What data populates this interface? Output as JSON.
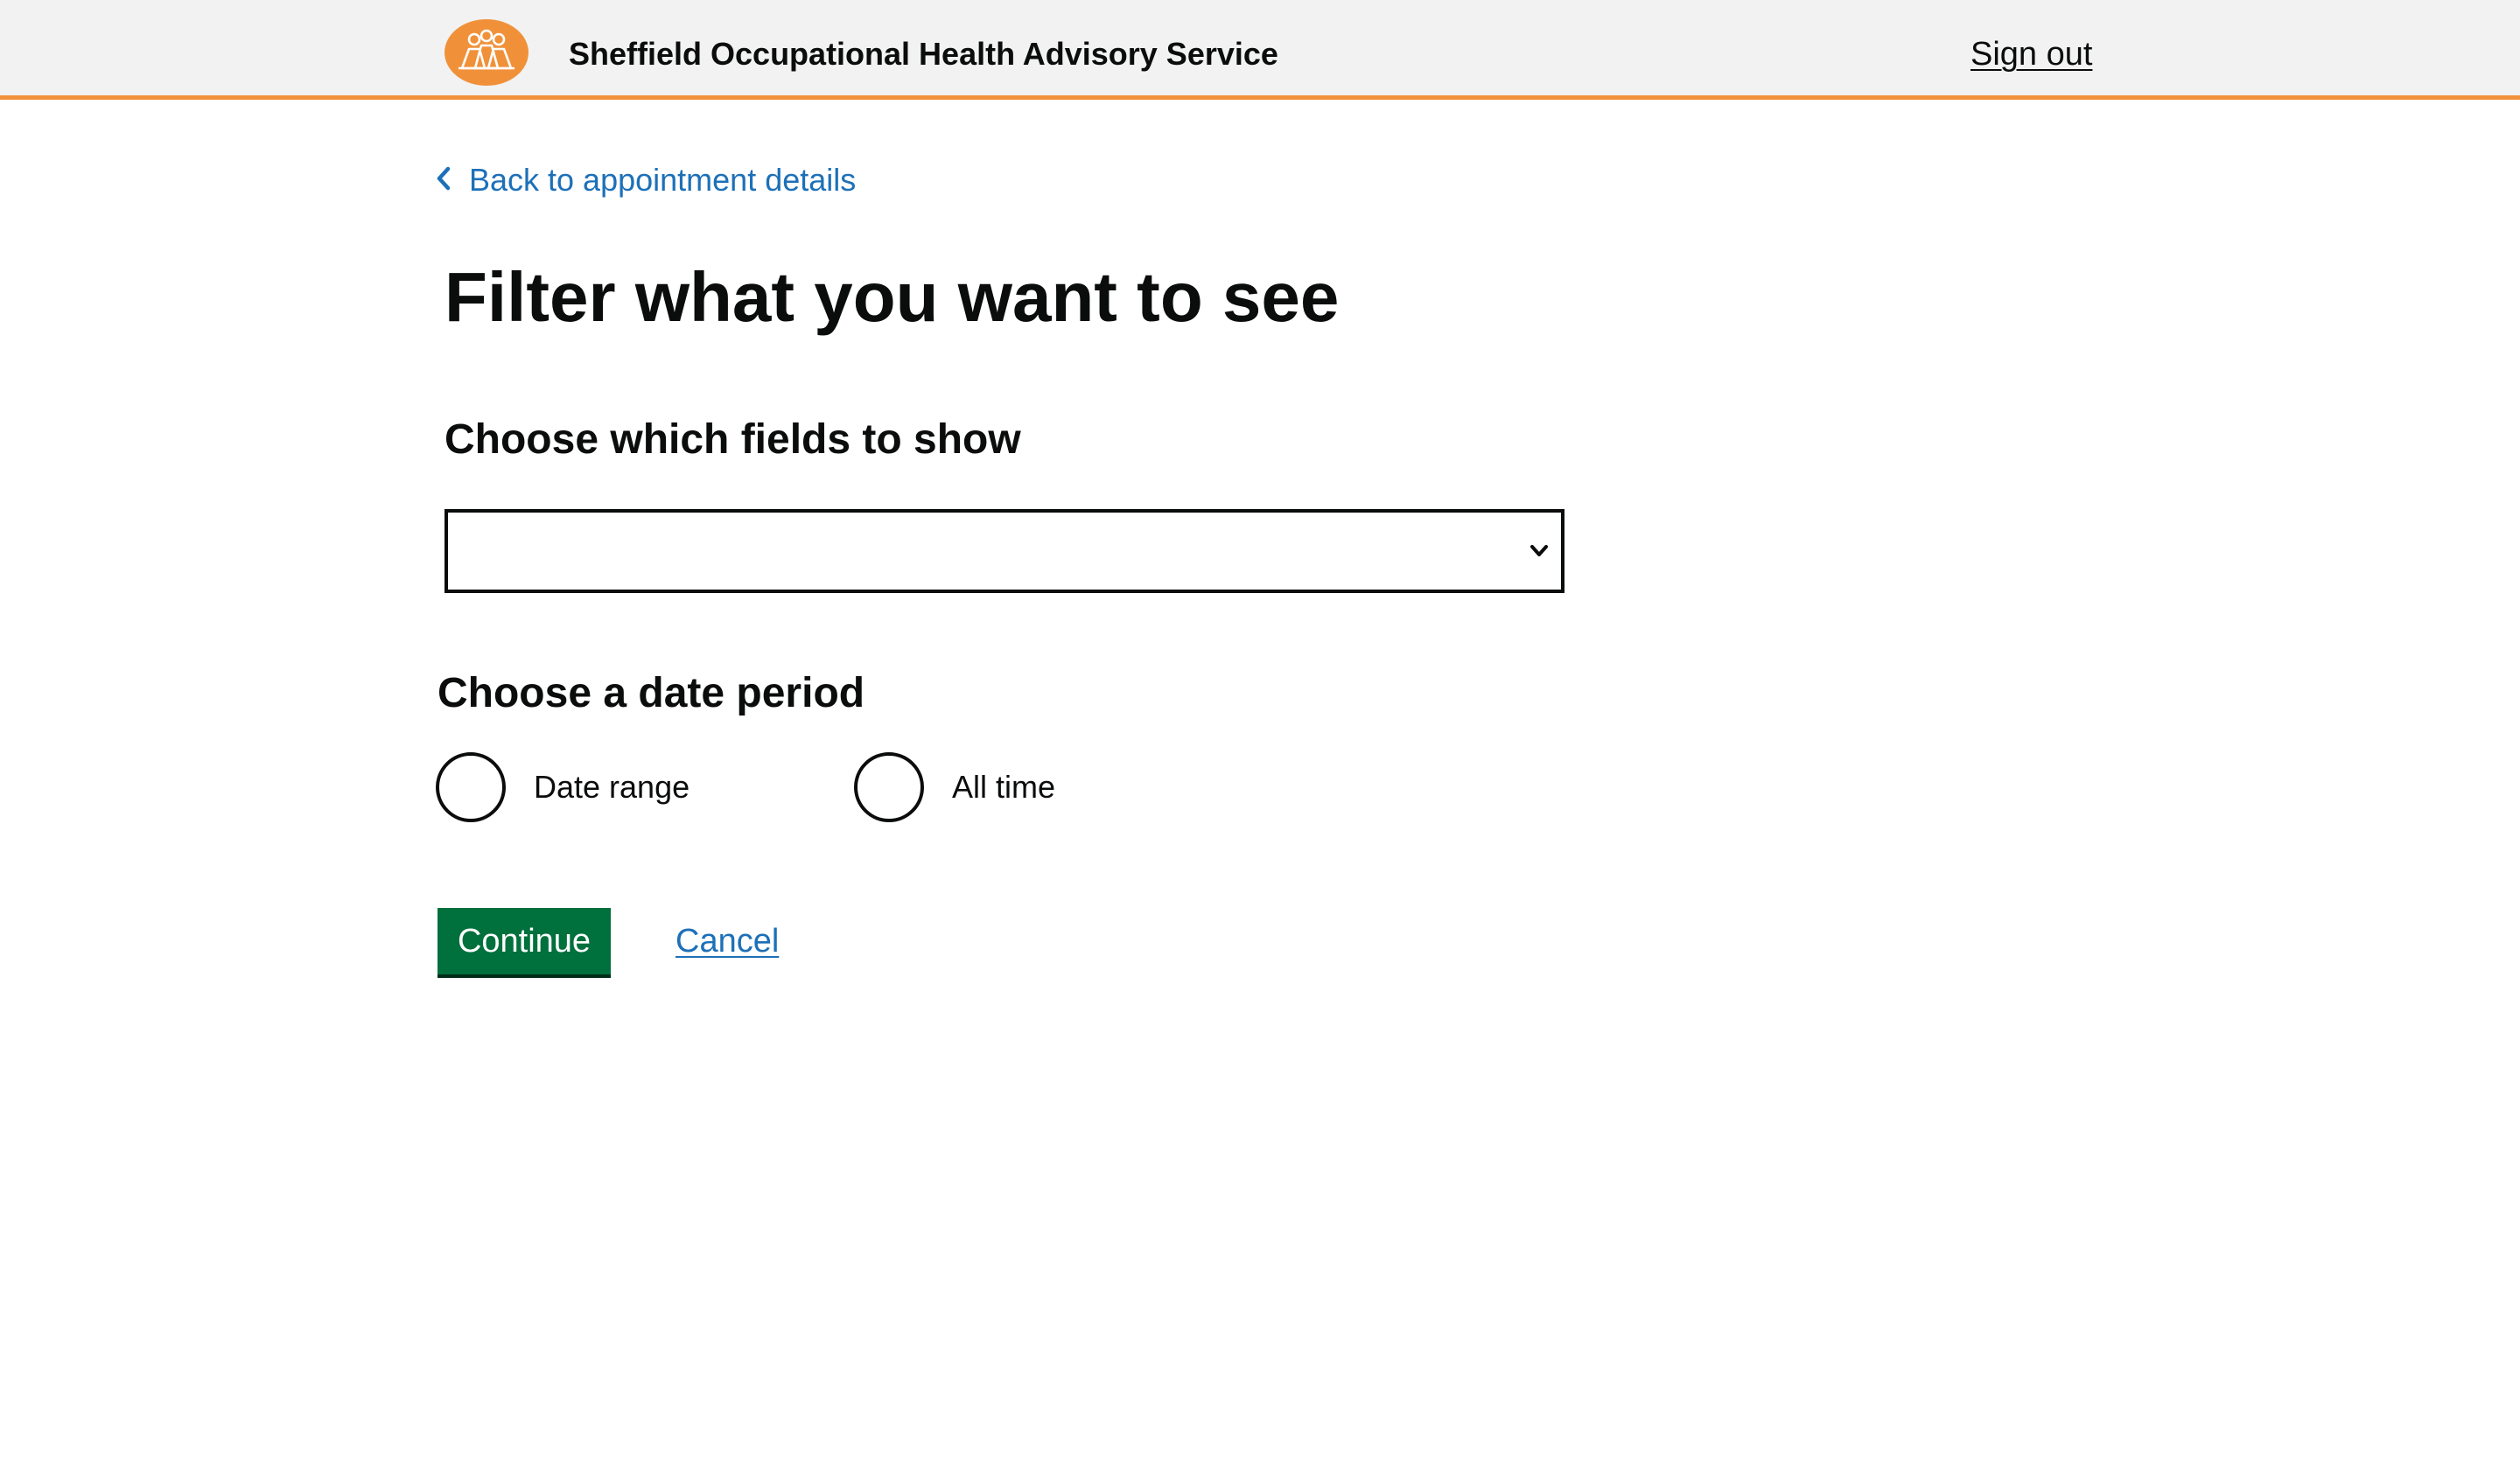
{
  "colors": {
    "header_background": "#f2f2f2",
    "header_accent": "#f0913a",
    "logo": "#f0913a",
    "link": "#1d70b8",
    "primary_button": "#00703c",
    "text": "#0b0c0c"
  },
  "header": {
    "logo_icon": "people-group-icon",
    "service_name": "Sheffield Occupational Health Advisory Service",
    "sign_out_label": "Sign out"
  },
  "back_link": {
    "icon": "chevron-left-icon",
    "label": "Back to appointment details"
  },
  "page": {
    "title": "Filter what you want to see"
  },
  "fields_select": {
    "label": "Choose which fields to show",
    "selected_value": "",
    "icon": "chevron-down-icon"
  },
  "date_period": {
    "label": "Choose a date period",
    "options": [
      {
        "label": "Date range",
        "checked": false
      },
      {
        "label": "All time",
        "checked": false
      }
    ]
  },
  "actions": {
    "continue_label": "Continue",
    "cancel_label": "Cancel"
  }
}
